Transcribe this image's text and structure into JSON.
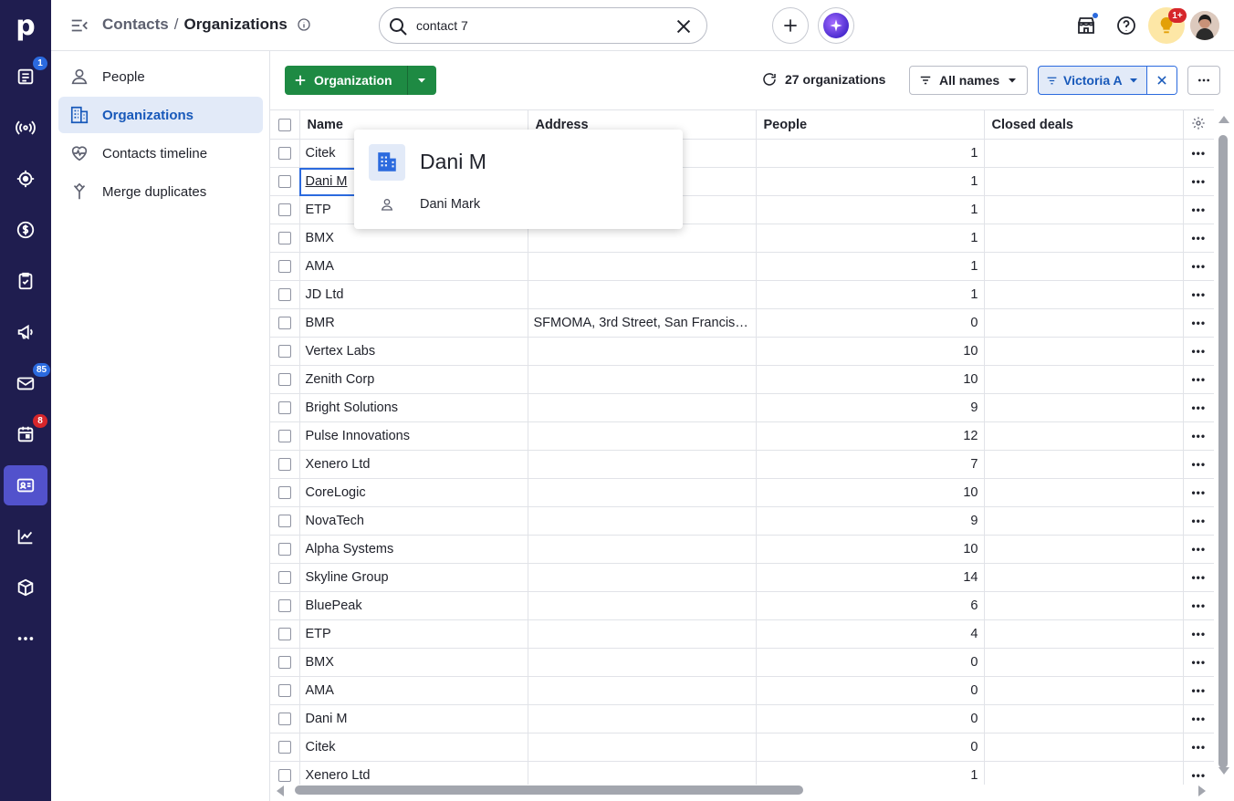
{
  "rail": {
    "badges": {
      "leads": "1",
      "mail": "85",
      "activities": "8"
    }
  },
  "topbar": {
    "breadcrumb_parent": "Contacts",
    "breadcrumb_separator": "/",
    "breadcrumb_current": "Organizations",
    "search_value": "contact 7",
    "notification_badge": "1+"
  },
  "sidenav": {
    "items": [
      {
        "label": "People",
        "icon": "person-icon"
      },
      {
        "label": "Organizations",
        "icon": "building-icon"
      },
      {
        "label": "Contacts timeline",
        "icon": "heart-pulse-icon"
      },
      {
        "label": "Merge duplicates",
        "icon": "merge-icon"
      }
    ]
  },
  "toolbar": {
    "add_label": "Organization",
    "count_label": "27 organizations",
    "filter_label": "All names",
    "user_filter_label": "Victoria A"
  },
  "table": {
    "headers": [
      "Name",
      "Address",
      "People",
      "Closed deals"
    ],
    "rows": [
      {
        "name": "Citek",
        "address": "",
        "people": "1",
        "deals": ""
      },
      {
        "name": "Dani M",
        "address": "",
        "people": "1",
        "deals": ""
      },
      {
        "name": "ETP",
        "address": "",
        "people": "1",
        "deals": ""
      },
      {
        "name": "BMX",
        "address": "",
        "people": "1",
        "deals": ""
      },
      {
        "name": "AMA",
        "address": "",
        "people": "1",
        "deals": ""
      },
      {
        "name": "JD Ltd",
        "address": "",
        "people": "1",
        "deals": ""
      },
      {
        "name": "BMR",
        "address": "SFMOMA, 3rd Street, San Francis…",
        "people": "0",
        "deals": ""
      },
      {
        "name": "Vertex Labs",
        "address": "",
        "people": "10",
        "deals": ""
      },
      {
        "name": "Zenith Corp",
        "address": "",
        "people": "10",
        "deals": ""
      },
      {
        "name": "Bright Solutions",
        "address": "",
        "people": "9",
        "deals": ""
      },
      {
        "name": "Pulse Innovations",
        "address": "",
        "people": "12",
        "deals": ""
      },
      {
        "name": "Xenero Ltd",
        "address": "",
        "people": "7",
        "deals": ""
      },
      {
        "name": "CoreLogic",
        "address": "",
        "people": "10",
        "deals": ""
      },
      {
        "name": "NovaTech",
        "address": "",
        "people": "9",
        "deals": ""
      },
      {
        "name": "Alpha Systems",
        "address": "",
        "people": "10",
        "deals": ""
      },
      {
        "name": "Skyline Group",
        "address": "",
        "people": "14",
        "deals": ""
      },
      {
        "name": "BluePeak",
        "address": "",
        "people": "6",
        "deals": ""
      },
      {
        "name": "ETP",
        "address": "",
        "people": "4",
        "deals": ""
      },
      {
        "name": "BMX",
        "address": "",
        "people": "0",
        "deals": ""
      },
      {
        "name": "AMA",
        "address": "",
        "people": "0",
        "deals": ""
      },
      {
        "name": "Dani M",
        "address": "",
        "people": "0",
        "deals": ""
      },
      {
        "name": "Citek",
        "address": "",
        "people": "0",
        "deals": ""
      },
      {
        "name": "Xenero Ltd",
        "address": "",
        "people": "1",
        "deals": ""
      }
    ]
  },
  "popup": {
    "title": "Dani M",
    "person": "Dani Mark"
  },
  "colors": {
    "rail_bg": "#1f1d4f",
    "accent_green": "#1e8a43",
    "accent_blue": "#2b6ade",
    "active_nav_bg": "#e2eaf8"
  }
}
